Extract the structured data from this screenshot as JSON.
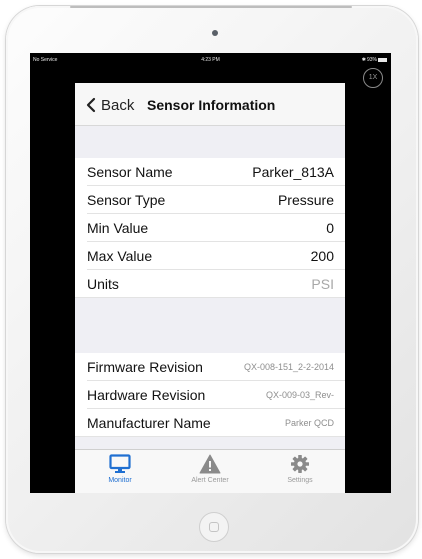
{
  "status_bar": {
    "carrier": "No Service",
    "time": "4:23 PM",
    "battery": "93%",
    "battery_level": 0.93
  },
  "zoom_badge": "1X",
  "nav": {
    "back_label": "Back",
    "title": "Sensor Information"
  },
  "sensor_rows": [
    {
      "label": "Sensor Name",
      "value": "Parker_813A"
    },
    {
      "label": "Sensor Type",
      "value": "Pressure"
    },
    {
      "label": "Min Value",
      "value": "0"
    },
    {
      "label": "Max Value",
      "value": "200"
    },
    {
      "label": "Units",
      "value": "PSI"
    }
  ],
  "device_rows": [
    {
      "label": "Firmware Revision",
      "value": "QX-008-151_2-2-2014"
    },
    {
      "label": "Hardware Revision",
      "value": "QX-009-03_Rev-"
    },
    {
      "label": "Manufacturer Name",
      "value": "Parker QCD"
    }
  ],
  "tabs": [
    {
      "label": "Monitor",
      "icon": "monitor-icon",
      "active": true
    },
    {
      "label": "Alert Center",
      "icon": "warning-icon",
      "active": false
    },
    {
      "label": "Settings",
      "icon": "gear-icon",
      "active": false
    }
  ],
  "colors": {
    "accent": "#1f6fd1",
    "inactive_tab": "#9a9a9a",
    "muted_value": "#a8a8a8"
  }
}
